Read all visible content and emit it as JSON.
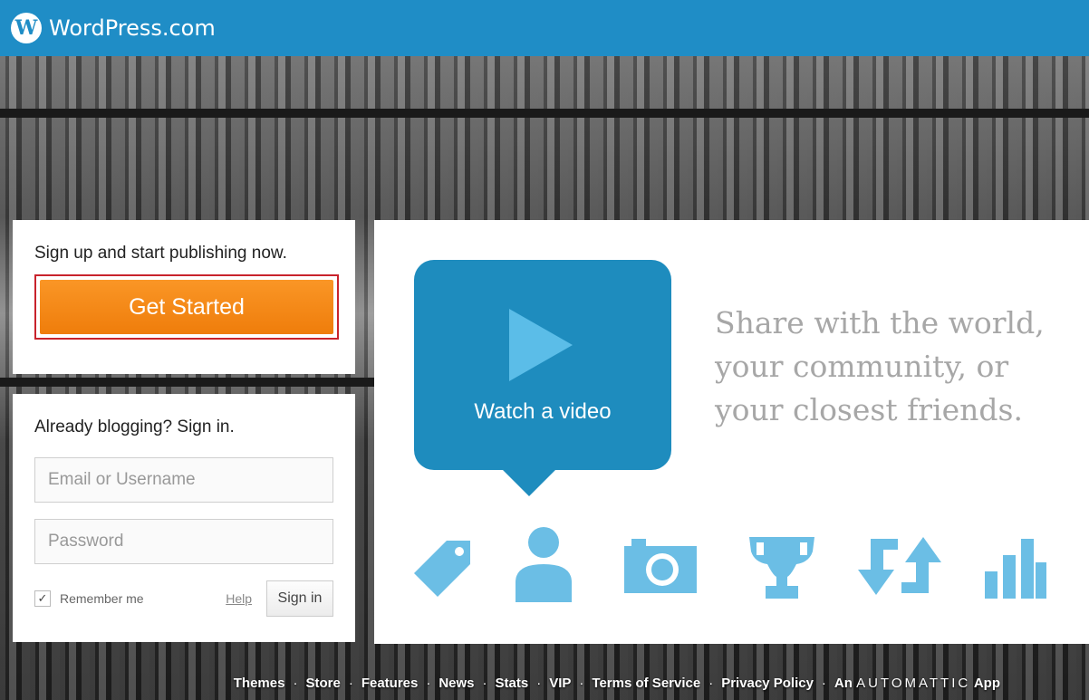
{
  "header": {
    "brand": "WordPress.com",
    "logo_letter": "W"
  },
  "signup": {
    "tagline": "Sign up and start publishing now.",
    "cta_label": "Get Started"
  },
  "signin": {
    "heading": "Already blogging? Sign in.",
    "email_placeholder": "Email or Username",
    "password_placeholder": "Password",
    "remember_label": "Remember me",
    "remember_checked": true,
    "help_label": "Help",
    "submit_label": "Sign in"
  },
  "promo": {
    "video_label": "Watch a video",
    "tagline_lines": [
      "Share with the world,",
      "your community, or",
      "your closest friends."
    ],
    "icons": [
      "tag-icon",
      "person-icon",
      "camera-icon",
      "trophy-icon",
      "reblog-arrows-icon",
      "stats-bars-icon"
    ]
  },
  "footer": {
    "links": [
      "Themes",
      "Store",
      "Features",
      "News",
      "Stats",
      "VIP",
      "Terms of Service",
      "Privacy Policy"
    ],
    "automattic_prefix": "An",
    "automattic_brand": "AUTOMATTIC",
    "automattic_suffix": "App"
  },
  "colors": {
    "topbar": "#1f8dc6",
    "cta": "#f38b1a",
    "video": "#1e8cbe",
    "icons": "#6bbee5"
  }
}
